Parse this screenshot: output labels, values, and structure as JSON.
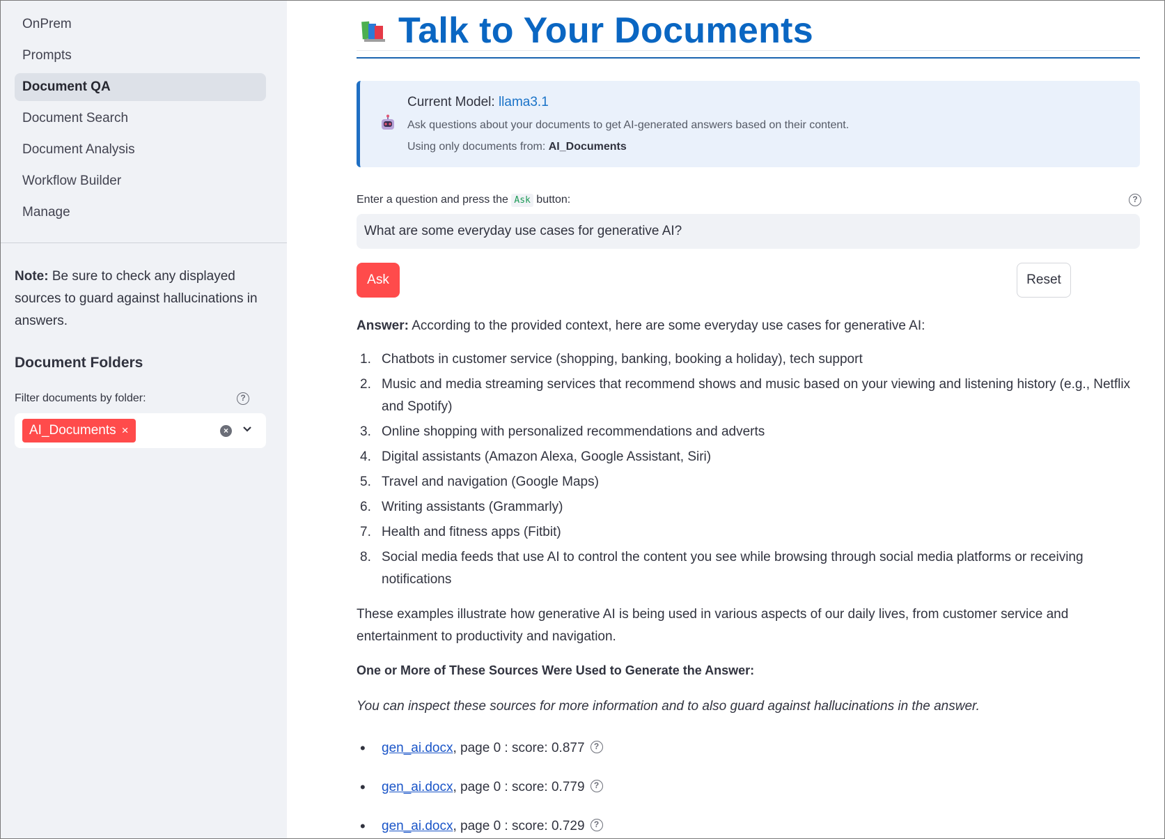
{
  "sidebar": {
    "nav": [
      {
        "label": "OnPrem",
        "active": false
      },
      {
        "label": "Prompts",
        "active": false
      },
      {
        "label": "Document QA",
        "active": true
      },
      {
        "label": "Document Search",
        "active": false
      },
      {
        "label": "Document Analysis",
        "active": false
      },
      {
        "label": "Workflow Builder",
        "active": false
      },
      {
        "label": "Manage",
        "active": false
      }
    ],
    "note_bold": "Note:",
    "note_text": " Be sure to check any displayed sources to guard against hallucinations in answers.",
    "folders_title": "Document Folders",
    "filter_label": "Filter documents by folder:",
    "selected_folder": "AI_Documents",
    "tag_remove": "×",
    "clear_icon": "×",
    "chevron_icon": "⌄"
  },
  "main": {
    "title": "Talk to Your Documents",
    "info": {
      "model_prefix": "Current Model: ",
      "model": "llama3.1",
      "description": "Ask questions about your documents to get AI-generated answers based on their content.",
      "using_prefix": "Using only documents from: ",
      "using_folder": "AI_Documents"
    },
    "question_label_pre": "Enter a question and press the ",
    "question_label_code": "Ask",
    "question_label_post": " button:",
    "question_value": "What are some everyday use cases for generative AI?",
    "ask_label": "Ask",
    "reset_label": "Reset",
    "answer_bold": "Answer:",
    "answer_intro": " According to the provided context, here are some everyday use cases for generative AI:",
    "answer_items": [
      "Chatbots in customer service (shopping, banking, booking a holiday), tech support",
      "Music and media streaming services that recommend shows and music based on your viewing and listening history (e.g., Netflix and Spotify)",
      "Online shopping with personalized recommendations and adverts",
      "Digital assistants (Amazon Alexa, Google Assistant, Siri)",
      "Travel and navigation (Google Maps)",
      "Writing assistants (Grammarly)",
      "Health and fitness apps (Fitbit)",
      "Social media feeds that use AI to control the content you see while browsing through social media platforms or receiving notifications"
    ],
    "conclusion": "These examples illustrate how generative AI is being used in various aspects of our daily lives, from customer service and entertainment to productivity and navigation.",
    "sources_title": "One or More of These Sources Were Used to Generate the Answer:",
    "sources_note": "You can inspect these sources for more information and to also guard against hallucinations in the answer.",
    "sources": [
      {
        "file": "gen_ai.docx",
        "detail": ", page 0 : score: 0.877"
      },
      {
        "file": "gen_ai.docx",
        "detail": ", page 0 : score: 0.779"
      },
      {
        "file": "gen_ai.docx",
        "detail": ", page 0 : score: 0.729"
      }
    ]
  },
  "colors": {
    "accent": "#ff4b4b",
    "title_blue": "#0a66c2",
    "link_blue": "#1a55c8",
    "sidebar_bg": "#f0f2f6",
    "info_bg": "#eaf1fb"
  }
}
